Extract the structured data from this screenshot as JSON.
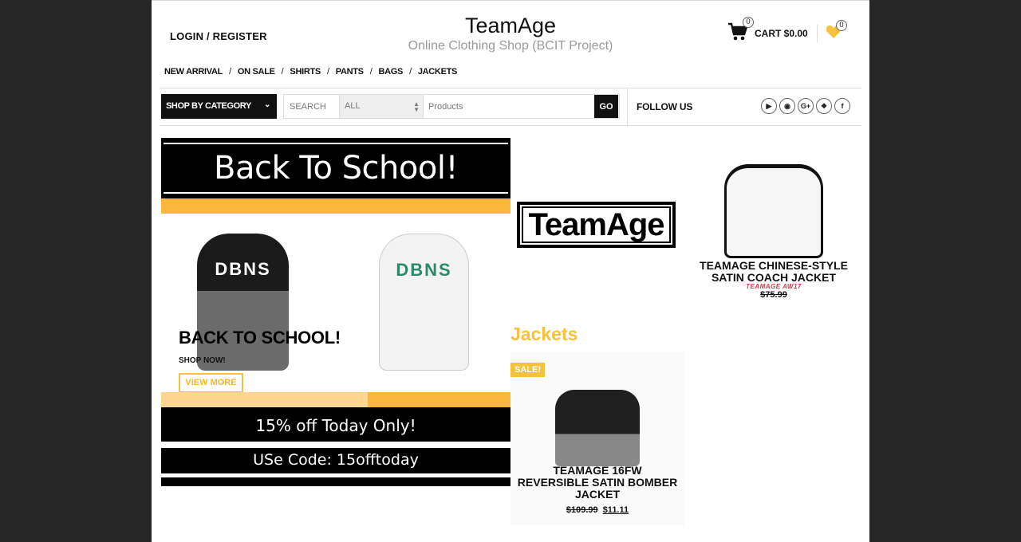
{
  "header": {
    "login_label": "LOGIN / REGISTER",
    "title": "TeamAge",
    "subtitle": "Online Clothing Shop (BCIT Project)",
    "cart_label": "CART $0.00",
    "cart_count": "0",
    "wishlist_count": "0"
  },
  "nav": {
    "items": [
      "NEW ARRIVAL",
      "ON SALE",
      "SHIRTS",
      "PANTS",
      "BAGS",
      "JACKETS"
    ],
    "separator": "/"
  },
  "search": {
    "category_button": "SHOP BY CATEGORY",
    "label": "SEARCH",
    "select_value": "ALL",
    "placeholder": "Products",
    "go_label": "GO"
  },
  "social": {
    "follow_label": "FOLLOW US",
    "icons": [
      "youtube-icon",
      "instagram-icon",
      "google-plus-icon",
      "twitter-icon",
      "facebook-icon"
    ]
  },
  "banner": {
    "headline": "Back To School!",
    "bag_text_1": "DBNS",
    "bag_text_2": "DBNS",
    "overlay_title": "BACK TO SCHOOL!",
    "shop_now": "SHOP NOW!",
    "view_more": "VIEW MORE",
    "promo_1": "15% off Today  Only!",
    "promo_2": "USe Code: 15offtoday"
  },
  "logo_text": "TeamAge",
  "products": {
    "featured": {
      "name_line1": "TEAMAGE CHINESE-STYLE",
      "name_line2": "SATIN COACH JACKET",
      "subtitle": "TEAMAGE AW17",
      "price": "$75.99"
    },
    "section_title": "Jackets",
    "sale_item": {
      "badge": "SALE!",
      "name_line1": "TEAMAGE 16FW",
      "name_line2": "REVERSIBLE SATIN BOMBER",
      "name_line3": "JACKET",
      "old_price": "$109.99",
      "new_price": "$11.11"
    }
  },
  "colors": {
    "accent": "#fcb83e",
    "sale_yellow": "#f4c23d",
    "background": "#262626"
  }
}
